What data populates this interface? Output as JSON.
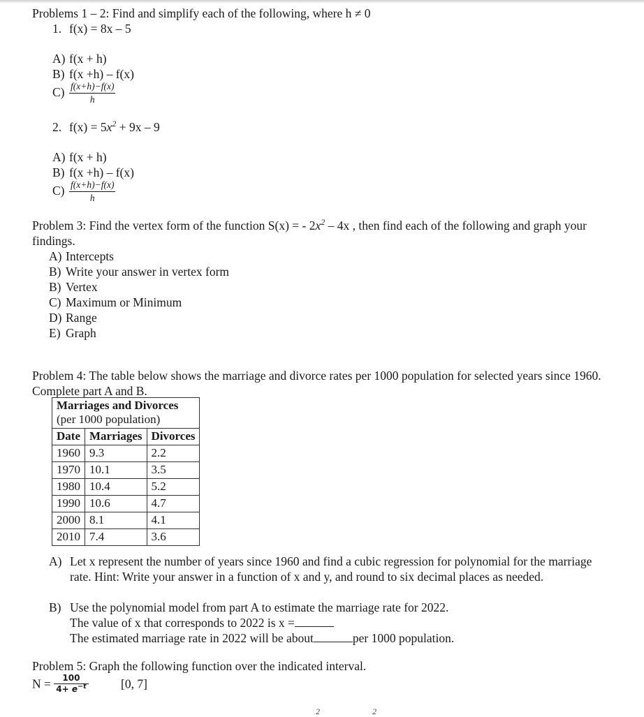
{
  "document": {
    "problems_1_2_heading": "Problems 1 – 2: Find and simplify each of the following, where h ≠ 0",
    "problem1": {
      "number": "1.",
      "function_prefix": "f(x) = 8x – 5",
      "parts": [
        {
          "label": "A)",
          "text": "f(x + h)"
        },
        {
          "label": "B)",
          "text": "f(x +h) – f(x)"
        },
        {
          "label": "C)",
          "numerator": "f(x+h)−f(x)",
          "denominator": "h"
        }
      ]
    },
    "problem2": {
      "number": "2.",
      "function_lead": "f(x) = 5",
      "function_var": "x",
      "function_exp": "2",
      "function_tail": " + 9x – 9",
      "parts": [
        {
          "label": "A)",
          "text": "f(x + h)"
        },
        {
          "label": "B)",
          "text": "f(x +h) – f(x)"
        },
        {
          "label": "C)",
          "numerator": "f(x+h)−f(x)",
          "denominator": "h"
        }
      ]
    },
    "problem3": {
      "lead": "Problem 3: Find the vertex form of the function S(x) = - 2",
      "var": "x",
      "exp": "2",
      "tail": " – 4x , then find each of the following and graph your findings.",
      "items": [
        {
          "label": "A)",
          "text": "Intercepts"
        },
        {
          "label": "B)",
          "text": "Write your answer in vertex form"
        },
        {
          "label": "B)",
          "text": "Vertex"
        },
        {
          "label": "C)",
          "text": "Maximum or Minimum"
        },
        {
          "label": "D)",
          "text": "Range"
        },
        {
          "label": "E)",
          "text": "Graph"
        }
      ]
    },
    "problem4": {
      "intro": "Problem 4: The table below shows the marriage and divorce rates per 1000 population for selected years since 1960. Complete part A and B.",
      "table": {
        "title": "Marriages and Divorces",
        "subtitle": "(per 1000 population)",
        "columns": [
          "Date",
          "Marriages",
          "Divorces"
        ],
        "rows": [
          [
            "1960",
            "9.3",
            "2.2"
          ],
          [
            "1970",
            "10.1",
            "3.5"
          ],
          [
            "1980",
            "10.4",
            "5.2"
          ],
          [
            "1990",
            "10.6",
            "4.7"
          ],
          [
            "2000",
            "8.1",
            "4.1"
          ],
          [
            "2010",
            "7.4",
            "3.6"
          ]
        ]
      },
      "part_a_label": "A)",
      "part_a_text": "Let x represent the number of years since 1960 and find a cubic regression for polynomial for the marriage rate. Hint: Write your answer in a function of x and y, and round to six decimal places as needed.",
      "part_b_label": "B)",
      "part_b_text": "Use the polynomial model from part A to estimate the marriage rate for 2022.",
      "part_b_line1_pre": "The value of x that corresponds to 2022 is x =",
      "part_b_line2_pre": "The estimated marriage rate in 2022 will be about",
      "part_b_line2_post": "per 1000 population."
    },
    "problem5": {
      "intro": "Problem 5: Graph the following function over the indicated interval.",
      "formula_lead": "N =",
      "numerator": "100",
      "denominator_lead": "4+ ",
      "denominator_base": "e",
      "denominator_exp": "−t",
      "interval": "[0, 7]"
    },
    "cut_off_row": {
      "sup_left": "2",
      "sup_right": "2"
    }
  }
}
